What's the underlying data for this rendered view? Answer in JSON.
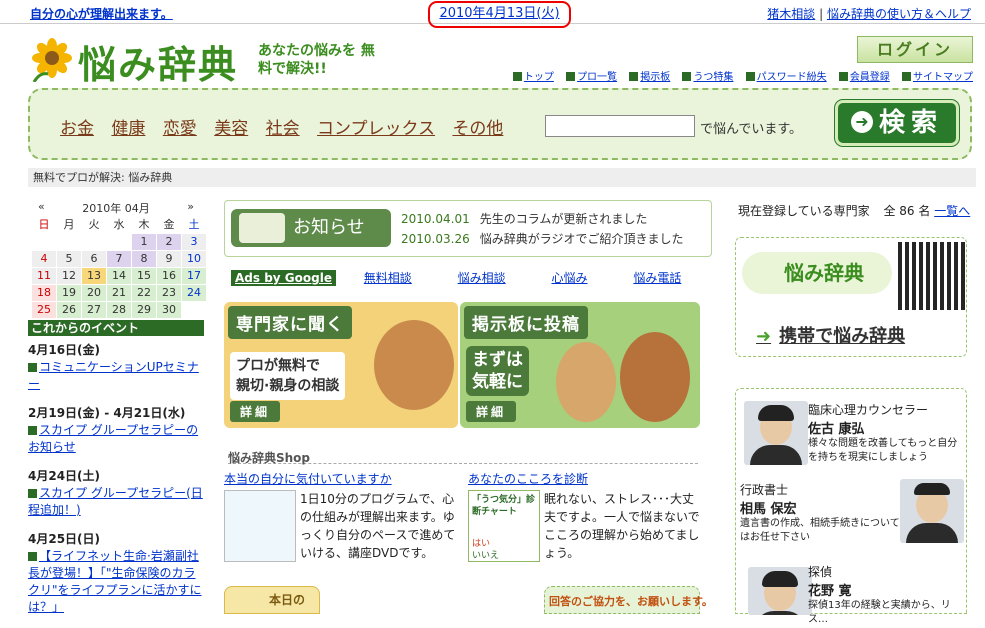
{
  "topbar": {
    "tagline": "自分の心が理解出来ます。",
    "date": "2010年4月13日(火)",
    "links": [
      "猪木相談",
      "悩み辞典の使い方＆ヘルプ"
    ],
    "separator": "|"
  },
  "logo": {
    "title": "悩み辞典",
    "subtitle": "あなたの悩みを 無料で解決!!"
  },
  "login_label": "ログイン",
  "nav": [
    "トップ",
    "プロ一覧",
    "掲示板",
    "うつ特集",
    "パスワード紛失",
    "会員登録",
    "サイトマップ"
  ],
  "search": {
    "categories": [
      "お金",
      "健康",
      "恋愛",
      "美容",
      "社会",
      "コンプレックス",
      "その他"
    ],
    "value": "",
    "suffix": "で悩んでいます。",
    "button": "検索"
  },
  "breadcrumb": "無料でプロが解決: 悩み辞典",
  "calendar": {
    "prev": "«",
    "next": "»",
    "month": "2010年 04月",
    "weekdays": [
      "日",
      "月",
      "火",
      "水",
      "木",
      "金",
      "土"
    ],
    "days": [
      [
        "",
        "",
        "",
        "",
        "1",
        "2",
        "3"
      ],
      [
        "4",
        "5",
        "6",
        "7",
        "8",
        "9",
        "10"
      ],
      [
        "11",
        "12",
        "13",
        "14",
        "15",
        "16",
        "17"
      ],
      [
        "18",
        "19",
        "20",
        "21",
        "22",
        "23",
        "24"
      ],
      [
        "25",
        "26",
        "27",
        "28",
        "29",
        "30",
        ""
      ]
    ],
    "today": "13",
    "marked": [
      "1",
      "2",
      "7",
      "8"
    ]
  },
  "events": {
    "title": "これからのイベント",
    "items": [
      {
        "date": "4月16日(金)",
        "title": "コミュニケーションUPセミナー"
      },
      {
        "date": "2月19日(金) - 4月21日(水)",
        "title": "スカイプ グループセラピーのお知らせ"
      },
      {
        "date": "4月24日(土)",
        "title": "スカイプ グループセラピー(日程追加！)"
      },
      {
        "date": "4月25日(日)",
        "title": "【ライフネット生命·岩瀬副社長が登場！】「\"生命保険のカラクリ\"をライフプランに活かすには？」"
      }
    ]
  },
  "news": {
    "label": "お知らせ",
    "items": [
      {
        "date": "2010.04.01",
        "text": "先生のコラムが更新されました"
      },
      {
        "date": "2010.03.26",
        "text": "悩み辞典がラジオでご紹介頂きました"
      }
    ]
  },
  "ads": {
    "label": "Ads by Google",
    "links": [
      "無料相談",
      "悩み相談",
      "心悩み",
      "悩み電話"
    ]
  },
  "promo1": {
    "head": "専門家に聞く",
    "line1": "プロが無料で",
    "line2": "親切·親身の相談",
    "detail": "詳細"
  },
  "promo2": {
    "head": "掲示板に投稿",
    "line1": "まずは",
    "line2": "気軽に",
    "detail": "詳細"
  },
  "shop": {
    "title": "悩み辞典Shop",
    "items": [
      {
        "link": "本当の自分に気付いていますか",
        "text": "1日10分のプログラムで、心の仕組みが理解出来ます。ゆっくり自分のペースで進めていける、講座DVDです。"
      },
      {
        "link": "あなたのこころを診断",
        "img": "「うつ気分」診断チャート",
        "yes": "はい",
        "no": "いいえ",
        "text": "眠れない、ストレス･･･大丈夫ですよ。一人で悩まないでこころの理解から始めてましょう。"
      }
    ]
  },
  "bottom": {
    "left": "本日の",
    "right": "回答のご協力を、お願いします。"
  },
  "experts": {
    "head": "現在登録している専門家",
    "count": "全 86 名",
    "list_link": "一覧へ",
    "mobile_label": "悩み辞典",
    "mobile_link": "携帯で悩み辞典",
    "items": [
      {
        "role": "臨床心理カウンセラー",
        "name": "佐古 康弘",
        "desc": "様々な問題を改善してもっと自分を持ちを現実にしましょう"
      },
      {
        "role": "行政書士",
        "name": "相馬 保宏",
        "desc": "遺言書の作成、相続手続きについてはお任せ下さい"
      },
      {
        "role": "探偵",
        "name": "花野 寛",
        "desc": "探偵13年の経験と実績から、リス…"
      }
    ]
  },
  "colors": {
    "brand": "#3a8d1e",
    "link": "#0033cc",
    "accent_dark": "#2c6b25"
  }
}
